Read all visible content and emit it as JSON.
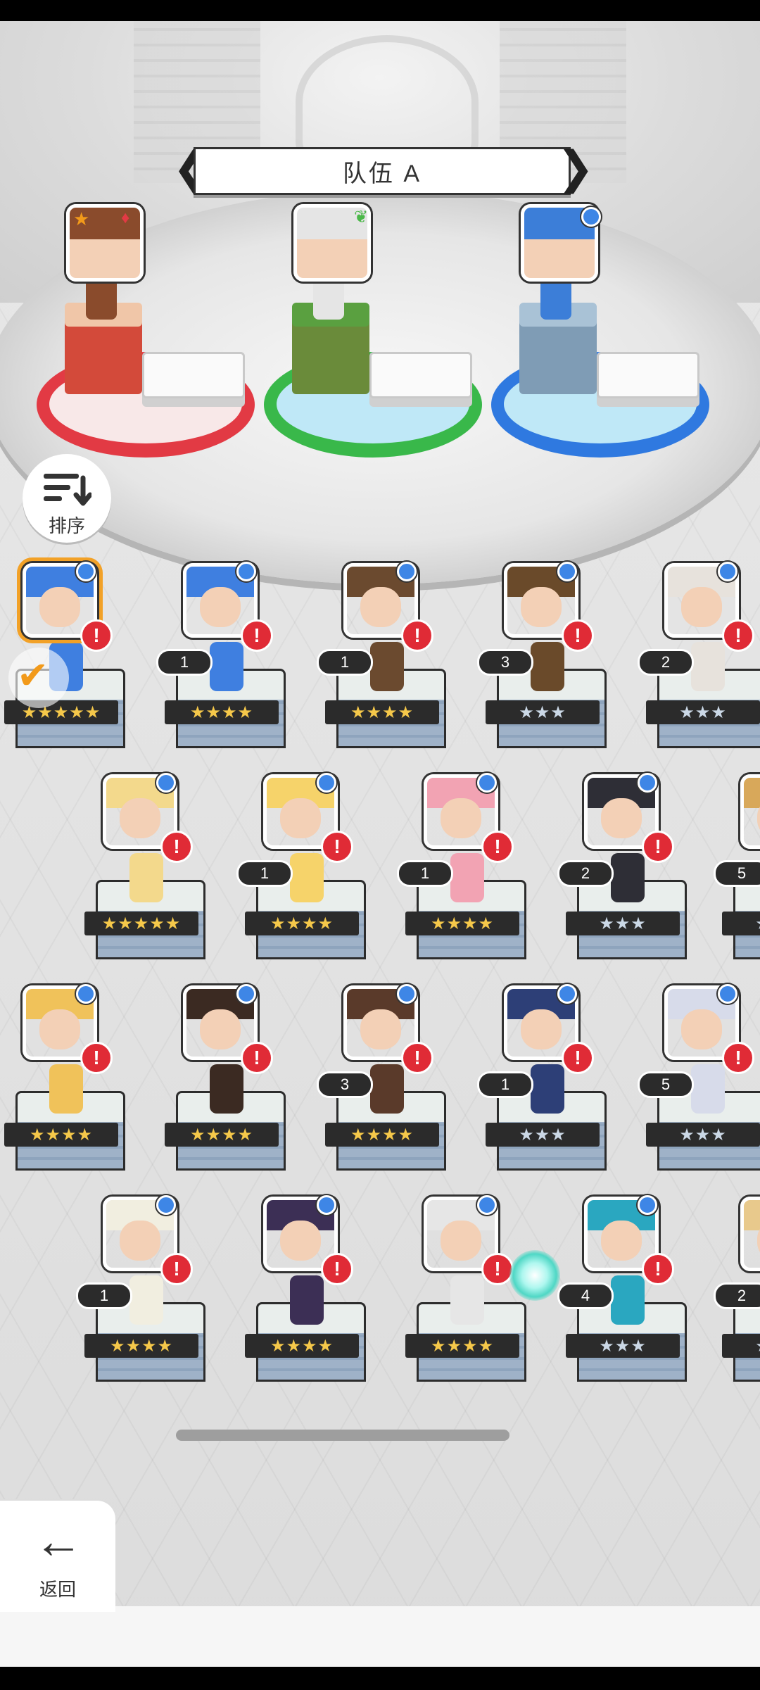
{
  "team": {
    "title": "队伍 A",
    "prev_arrow": "❮",
    "next_arrow": "❯",
    "slots": [
      {
        "name": "slot-1",
        "ring_color": "#e23a44",
        "cube_color": "#d34a3a",
        "hair_color": "#8a4b2c",
        "leader": true
      },
      {
        "name": "slot-2",
        "ring_color": "#39b84a",
        "cube_color": "#6a8b3a",
        "hair_color": "#e5e5e5",
        "leader": false
      },
      {
        "name": "slot-3",
        "ring_color": "#2f79e0",
        "cube_color": "#7f9cb5",
        "hair_color": "#3c7ed8",
        "leader": false
      }
    ]
  },
  "sort": {
    "label": "排序",
    "icon": "sort-icon"
  },
  "back": {
    "label": "返回",
    "icon": "arrow-left-icon"
  },
  "alert_symbol": "!",
  "check_symbol": "✔",
  "heroes": [
    {
      "row": 1,
      "col": 1,
      "hair": "#3f7fe0",
      "level": "",
      "stars": "★★★★★",
      "tier": "gold",
      "selected": true,
      "alert": true
    },
    {
      "row": 1,
      "col": 2,
      "hair": "#3f7fe0",
      "level": "1",
      "stars": "★★★★",
      "tier": "gold",
      "selected": false,
      "alert": true
    },
    {
      "row": 1,
      "col": 3,
      "hair": "#6b4a2f",
      "level": "1",
      "stars": "★★★★",
      "tier": "gold",
      "selected": false,
      "alert": true
    },
    {
      "row": 1,
      "col": 4,
      "hair": "#6a4a2a",
      "level": "3",
      "stars": "★★★",
      "tier": "silver",
      "selected": false,
      "alert": true
    },
    {
      "row": 1,
      "col": 5,
      "hair": "#e7e2dc",
      "level": "2",
      "stars": "★★★",
      "tier": "silver",
      "selected": false,
      "alert": true
    },
    {
      "row": 2,
      "col": 1,
      "hair": "#f3d98c",
      "level": "",
      "stars": "★★★★★",
      "tier": "gold",
      "selected": false,
      "alert": true
    },
    {
      "row": 2,
      "col": 2,
      "hair": "#f6d36a",
      "level": "1",
      "stars": "★★★★",
      "tier": "gold",
      "selected": false,
      "alert": true
    },
    {
      "row": 2,
      "col": 3,
      "hair": "#f2a3b3",
      "level": "1",
      "stars": "★★★★",
      "tier": "gold",
      "selected": false,
      "alert": true
    },
    {
      "row": 2,
      "col": 4,
      "hair": "#2e2e36",
      "level": "2",
      "stars": "★★★",
      "tier": "silver",
      "selected": false,
      "alert": true
    },
    {
      "row": 2,
      "col": 5,
      "hair": "#d8a85a",
      "level": "5",
      "stars": "★★★",
      "tier": "silver",
      "selected": false,
      "alert": false
    },
    {
      "row": 3,
      "col": 1,
      "hair": "#f0c25a",
      "level": "",
      "stars": "★★★★",
      "tier": "gold",
      "selected": false,
      "alert": true
    },
    {
      "row": 3,
      "col": 2,
      "hair": "#3b2a22",
      "level": "",
      "stars": "★★★★",
      "tier": "gold",
      "selected": false,
      "alert": true
    },
    {
      "row": 3,
      "col": 3,
      "hair": "#5a3a2a",
      "level": "3",
      "stars": "★★★★",
      "tier": "gold",
      "selected": false,
      "alert": true
    },
    {
      "row": 3,
      "col": 4,
      "hair": "#2d3f77",
      "level": "1",
      "stars": "★★★",
      "tier": "silver",
      "selected": false,
      "alert": true
    },
    {
      "row": 3,
      "col": 5,
      "hair": "#d7dbea",
      "level": "5",
      "stars": "★★★",
      "tier": "silver",
      "selected": false,
      "alert": true
    },
    {
      "row": 4,
      "col": 1,
      "hair": "#f1eee0",
      "level": "1",
      "stars": "★★★★",
      "tier": "gold",
      "selected": false,
      "alert": true
    },
    {
      "row": 4,
      "col": 2,
      "hair": "#3c2f55",
      "level": "",
      "stars": "★★★★",
      "tier": "gold",
      "selected": false,
      "alert": true
    },
    {
      "row": 4,
      "col": 3,
      "hair": "#e6e6e6",
      "level": "",
      "stars": "★★★★",
      "tier": "gold",
      "selected": false,
      "alert": true
    },
    {
      "row": 4,
      "col": 4,
      "hair": "#2aa7c0",
      "level": "4",
      "stars": "★★★",
      "tier": "silver",
      "selected": false,
      "alert": true
    },
    {
      "row": 4,
      "col": 5,
      "hair": "#e8c98c",
      "level": "2",
      "stars": "★★★",
      "tier": "silver",
      "selected": false,
      "alert": false
    }
  ]
}
